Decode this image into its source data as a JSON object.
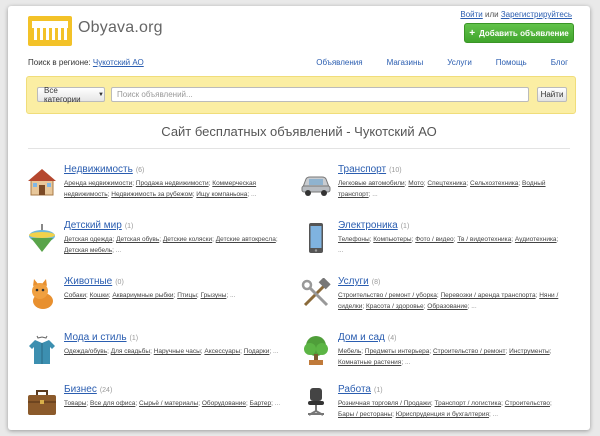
{
  "header": {
    "logo_text": "Obyava.org",
    "login": "Войти",
    "or": "или",
    "register": "Зарегистрируйтесь",
    "add_button": "Добавить объявление",
    "region_label": "Поиск в регионе:",
    "region_value": "Чукотский АО"
  },
  "nav": [
    "Объявления",
    "Магазины",
    "Услуги",
    "Помощь",
    "Блог"
  ],
  "search": {
    "category_label": "Все категории",
    "placeholder": "Поиск объявлений...",
    "button": "Найти"
  },
  "page_title": "Сайт бесплатных объявлений - Чукотский АО",
  "categories": [
    {
      "name": "Недвижимость",
      "count": "(6)",
      "icon": "house-icon",
      "subs": [
        "Аренда недвижимости",
        "Продажа недвижимости",
        "Коммерческая недвижимость",
        "Недвижимость за рубежом",
        "Ищу компаньона"
      ]
    },
    {
      "name": "Транспорт",
      "count": "(10)",
      "icon": "car-icon",
      "subs": [
        "Легковые автомобили",
        "Мото",
        "Спецтехника",
        "Сельхозтехника",
        "Водный транспорт"
      ]
    },
    {
      "name": "Детский мир",
      "count": "(1)",
      "icon": "spinning-top-icon",
      "subs": [
        "Детская одежда",
        "Детская обувь",
        "Детские коляски",
        "Детские автокресла",
        "Детская мебель"
      ]
    },
    {
      "name": "Электроника",
      "count": "(1)",
      "icon": "phone-icon",
      "subs": [
        "Телефоны",
        "Компьютеры",
        "Фото / видео",
        "Тв / видеотехника",
        "Аудиотехника"
      ]
    },
    {
      "name": "Животные",
      "count": "(0)",
      "icon": "cat-icon",
      "subs": [
        "Собаки",
        "Кошки",
        "Аквариумные рыбки",
        "Птицы",
        "Грызуны"
      ]
    },
    {
      "name": "Услуги",
      "count": "(8)",
      "icon": "tools-icon",
      "subs": [
        "Строительство / ремонт / уборка",
        "Перевозки / аренда транспорта",
        "Няни / сиделки",
        "Красота / здоровье",
        "Образование"
      ]
    },
    {
      "name": "Мода и стиль",
      "count": "(1)",
      "icon": "jacket-icon",
      "subs": [
        "Одежда/обувь",
        "Для свадьбы",
        "Наручные часы",
        "Аксессуары",
        "Подарки"
      ]
    },
    {
      "name": "Дом и сад",
      "count": "(4)",
      "icon": "tree-icon",
      "subs": [
        "Мебель",
        "Предметы интерьера",
        "Строительство / ремонт",
        "Инструменты",
        "Комнатные растения"
      ]
    },
    {
      "name": "Бизнес",
      "count": "(24)",
      "icon": "briefcase-icon",
      "subs": [
        "Товары",
        "Все для офиса",
        "Сырьё / материалы",
        "Оборудование",
        "Бартер"
      ]
    },
    {
      "name": "Работа",
      "count": "(1)",
      "icon": "office-chair-icon",
      "subs": [
        "Розничная торговля / Продажи",
        "Транспорт / логистика",
        "Строительство",
        "Бары / рестораны",
        "Юриспруденция и бухгалтерия"
      ]
    }
  ],
  "more": "...",
  "colors": {
    "link": "#2a5db0",
    "green": "#4cb035",
    "search_bg": "#fbeea3"
  }
}
